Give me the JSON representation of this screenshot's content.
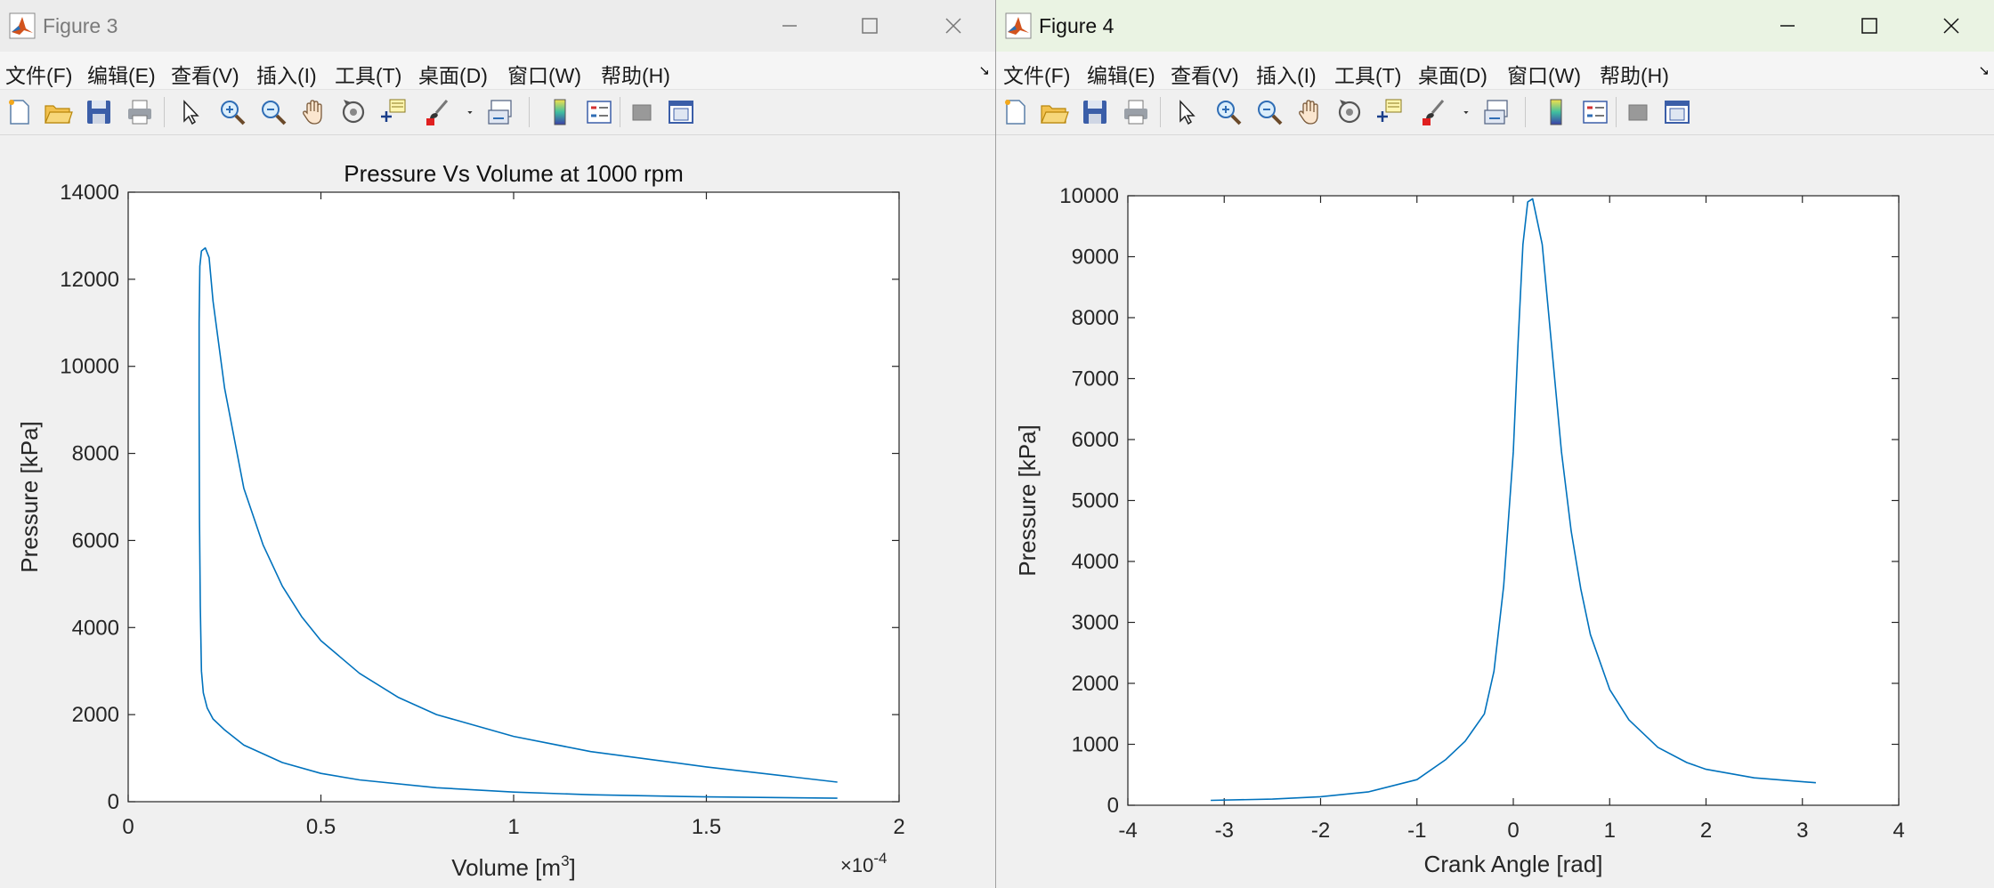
{
  "windows": [
    {
      "title": "Figure 3",
      "menu": [
        "文件(F)",
        "编辑(E)",
        "查看(V)",
        "插入(I)",
        "工具(T)",
        "桌面(D)",
        "窗口(W)",
        "帮助(H)"
      ],
      "toolbar_icons": [
        "new-figure-icon",
        "open-file-icon",
        "save-icon",
        "print-icon",
        "select-arrow-icon",
        "zoom-in-icon",
        "zoom-out-icon",
        "pan-hand-icon",
        "rotate-3d-icon",
        "data-cursor-icon",
        "brush-icon",
        "brush-dropdown-icon",
        "link-plot-icon",
        "colorbar-icon",
        "legend-icon",
        "hide-plot-tools-icon",
        "show-plot-tools-icon"
      ]
    },
    {
      "title": "Figure 4",
      "menu": [
        "文件(F)",
        "编辑(E)",
        "查看(V)",
        "插入(I)",
        "工具(T)",
        "桌面(D)",
        "窗口(W)",
        "帮助(H)"
      ],
      "toolbar_icons": [
        "new-figure-icon",
        "open-file-icon",
        "save-icon",
        "print-icon",
        "select-arrow-icon",
        "zoom-in-icon",
        "zoom-out-icon",
        "pan-hand-icon",
        "rotate-3d-icon",
        "data-cursor-icon",
        "brush-icon",
        "brush-dropdown-icon",
        "link-plot-icon",
        "colorbar-icon",
        "legend-icon",
        "hide-plot-tools-icon",
        "show-plot-tools-icon"
      ]
    }
  ],
  "colors": {
    "line": "#0072bd",
    "axes": "#262626"
  },
  "chart_data": [
    {
      "type": "line",
      "title": "Pressure Vs Volume at 1000 rpm",
      "xlabel": "Volume [m",
      "xlabel_sup": "3",
      "xlabel_end": "]",
      "ylabel": "Pressure [kPa]",
      "xlim": [
        0,
        2
      ],
      "ylim": [
        0,
        14000
      ],
      "x_exponent_label": "×10",
      "x_exponent_power": "-4",
      "xticks": [
        "0",
        "0.5",
        "1",
        "1.5",
        "2"
      ],
      "yticks": [
        "0",
        "2000",
        "4000",
        "6000",
        "8000",
        "10000",
        "12000",
        "14000"
      ],
      "series": [
        {
          "x": [
            1.84,
            1.5,
            1.2,
            1.0,
            0.8,
            0.6,
            0.5,
            0.4,
            0.3,
            0.25,
            0.22,
            0.205,
            0.195,
            0.19,
            0.187,
            0.185,
            0.184,
            0.184,
            0.186,
            0.19,
            0.2,
            0.21,
            0.22,
            0.25,
            0.3,
            0.35,
            0.4,
            0.45,
            0.5,
            0.6,
            0.7,
            0.8,
            1.0,
            1.2,
            1.5,
            1.84
          ],
          "y": [
            80,
            110,
            160,
            220,
            320,
            500,
            650,
            900,
            1300,
            1650,
            1900,
            2150,
            2500,
            3000,
            4500,
            6500,
            9000,
            11000,
            12300,
            12650,
            12720,
            12500,
            11500,
            9500,
            7200,
            5900,
            4950,
            4250,
            3700,
            2950,
            2400,
            2000,
            1500,
            1150,
            800,
            450
          ]
        }
      ]
    },
    {
      "type": "line",
      "title": "",
      "xlabel": "Crank Angle [rad]",
      "ylabel": "Pressure [kPa]",
      "xlim": [
        -4,
        4
      ],
      "ylim": [
        0,
        10000
      ],
      "xticks": [
        "-4",
        "-3",
        "-2",
        "-1",
        "0",
        "1",
        "2",
        "3",
        "4"
      ],
      "yticks": [
        "0",
        "1000",
        "2000",
        "3000",
        "4000",
        "5000",
        "6000",
        "7000",
        "8000",
        "9000",
        "10000"
      ],
      "series": [
        {
          "x": [
            -3.14,
            -2.5,
            -2.0,
            -1.5,
            -1.0,
            -0.7,
            -0.5,
            -0.3,
            -0.2,
            -0.1,
            0.0,
            0.05,
            0.1,
            0.15,
            0.2,
            0.3,
            0.4,
            0.5,
            0.6,
            0.7,
            0.8,
            1.0,
            1.2,
            1.5,
            1.8,
            2.0,
            2.5,
            3.14
          ],
          "y": [
            80,
            100,
            140,
            220,
            420,
            750,
            1050,
            1500,
            2200,
            3600,
            5800,
            7600,
            9200,
            9900,
            9950,
            9200,
            7500,
            5800,
            4500,
            3550,
            2800,
            1900,
            1400,
            950,
            700,
            590,
            450,
            370
          ]
        }
      ]
    }
  ]
}
